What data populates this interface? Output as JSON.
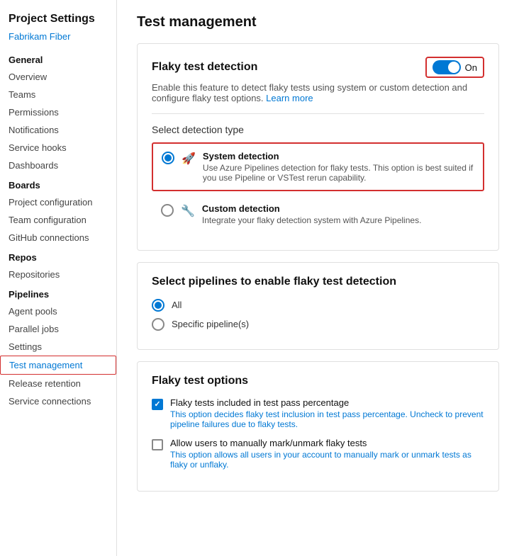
{
  "sidebar": {
    "title": "Project Settings",
    "subtitle": "Fabrikam Fiber",
    "sections": [
      {
        "label": "General",
        "items": [
          {
            "id": "overview",
            "label": "Overview",
            "active": false
          },
          {
            "id": "teams",
            "label": "Teams",
            "active": false
          },
          {
            "id": "permissions",
            "label": "Permissions",
            "active": false
          },
          {
            "id": "notifications",
            "label": "Notifications",
            "active": false
          },
          {
            "id": "service-hooks",
            "label": "Service hooks",
            "active": false
          },
          {
            "id": "dashboards",
            "label": "Dashboards",
            "active": false
          }
        ]
      },
      {
        "label": "Boards",
        "items": [
          {
            "id": "project-configuration",
            "label": "Project configuration",
            "active": false
          },
          {
            "id": "team-configuration",
            "label": "Team configuration",
            "active": false
          },
          {
            "id": "github-connections",
            "label": "GitHub connections",
            "active": false
          }
        ]
      },
      {
        "label": "Repos",
        "items": [
          {
            "id": "repositories",
            "label": "Repositories",
            "active": false
          }
        ]
      },
      {
        "label": "Pipelines",
        "items": [
          {
            "id": "agent-pools",
            "label": "Agent pools",
            "active": false
          },
          {
            "id": "parallel-jobs",
            "label": "Parallel jobs",
            "active": false
          },
          {
            "id": "settings",
            "label": "Settings",
            "active": false
          },
          {
            "id": "test-management",
            "label": "Test management",
            "active": true
          },
          {
            "id": "release-retention",
            "label": "Release retention",
            "active": false
          },
          {
            "id": "service-connections",
            "label": "Service connections",
            "active": false
          }
        ]
      }
    ]
  },
  "main": {
    "page_title": "Test management",
    "flaky_detection_card": {
      "title": "Flaky test detection",
      "toggle_label": "On",
      "toggle_on": true,
      "description": "Enable this feature to detect flaky tests using system or custom detection and configure flaky test options.",
      "learn_more_label": "Learn more",
      "detection_type_label": "Select detection type",
      "options": [
        {
          "id": "system",
          "label": "System detection",
          "description": "Use Azure Pipelines detection for flaky tests. This option is best suited if you use Pipeline or VSTest rerun capability.",
          "selected": true,
          "icon": "🚀"
        },
        {
          "id": "custom",
          "label": "Custom detection",
          "description": "Integrate your flaky detection system with Azure Pipelines.",
          "selected": false,
          "icon": "🔧"
        }
      ]
    },
    "pipelines_card": {
      "title": "Select pipelines to enable flaky test detection",
      "options": [
        {
          "id": "all",
          "label": "All",
          "selected": true
        },
        {
          "id": "specific",
          "label": "Specific pipeline(s)",
          "selected": false
        }
      ]
    },
    "flaky_options_card": {
      "title": "Flaky test options",
      "options": [
        {
          "id": "include-percentage",
          "label": "Flaky tests included in test pass percentage",
          "description": "This option decides flaky test inclusion in test pass percentage. Uncheck to prevent pipeline failures due to flaky tests.",
          "checked": true
        },
        {
          "id": "allow-manual",
          "label": "Allow users to manually mark/unmark flaky tests",
          "description": "This option allows all users in your account to manually mark or unmark tests as flaky or unflaky.",
          "checked": false
        }
      ]
    }
  }
}
